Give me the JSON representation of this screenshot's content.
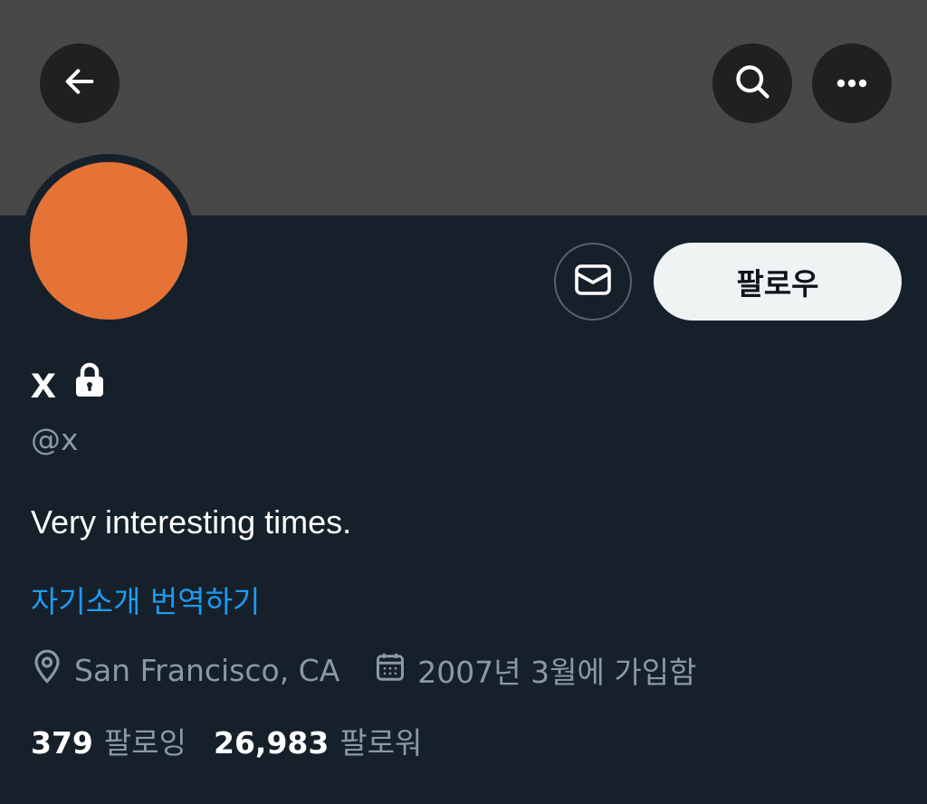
{
  "header": {
    "back_icon": "arrow-left-icon",
    "search_icon": "search-icon",
    "more_icon": "more-horizontal-icon",
    "banner_color": "#484848"
  },
  "profile": {
    "avatar_color": "#e57336",
    "display_name": "x",
    "protected_icon": "lock-icon",
    "handle": "@x",
    "bio": "Very interesting times.",
    "translate_bio": "자기소개 번역하기",
    "location": "San Francisco, CA",
    "location_icon": "location-pin-icon",
    "joined": "2007년 3월에 가입함",
    "joined_icon": "calendar-icon"
  },
  "actions": {
    "message_icon": "envelope-icon",
    "follow_label": "팔로우"
  },
  "stats": {
    "following_count": "379",
    "following_label": "팔로잉",
    "followers_count": "26,983",
    "followers_label": "팔로워"
  },
  "colors": {
    "background": "#16202b",
    "link": "#1d9bf0",
    "secondary_text": "#8b98a5"
  }
}
